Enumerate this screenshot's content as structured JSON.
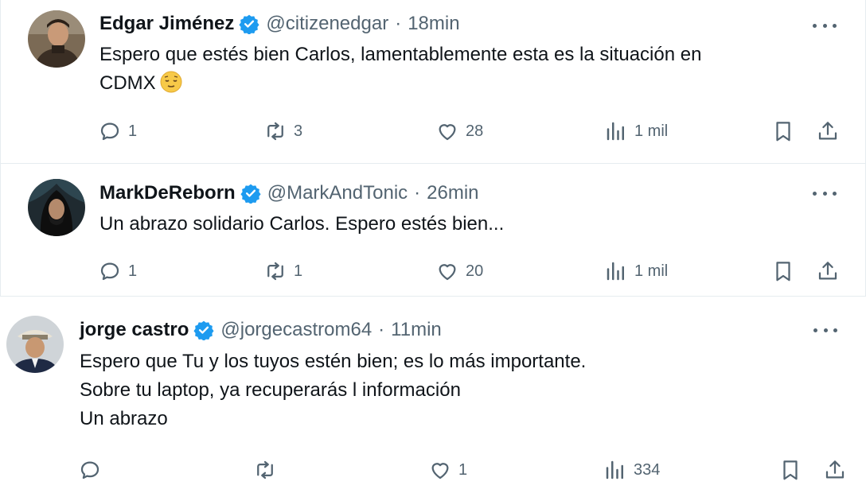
{
  "tweets": [
    {
      "name": "Edgar Jiménez",
      "handle": "@citizenedgar",
      "sep": "·",
      "time": "18min",
      "lines": [
        "Espero que estés bien Carlos, lamentablemente esta es la situación en",
        "CDMX"
      ],
      "emoji": "relieved-face",
      "replies": "1",
      "retweets": "3",
      "likes": "28",
      "views": "1 mil"
    },
    {
      "name": "MarkDeReborn",
      "handle": "@MarkAndTonic",
      "sep": "·",
      "time": "26min",
      "lines": [
        "Un abrazo solidario Carlos. Espero estés bien..."
      ],
      "replies": "1",
      "retweets": "1",
      "likes": "20",
      "views": "1 mil"
    },
    {
      "name": "jorge castro",
      "handle": "@jorgecastrom64",
      "sep": "·",
      "time": "11min",
      "lines": [
        "Espero que Tu y los tuyos estén bien; es lo más importante.",
        "Sobre tu laptop, ya recuperarás l información",
        "Un abrazo"
      ],
      "replies": "",
      "retweets": "",
      "likes": "1",
      "views": "334"
    }
  ],
  "colors": {
    "verified": "#1d9bf0",
    "muted": "#536471",
    "text": "#0f1419"
  }
}
